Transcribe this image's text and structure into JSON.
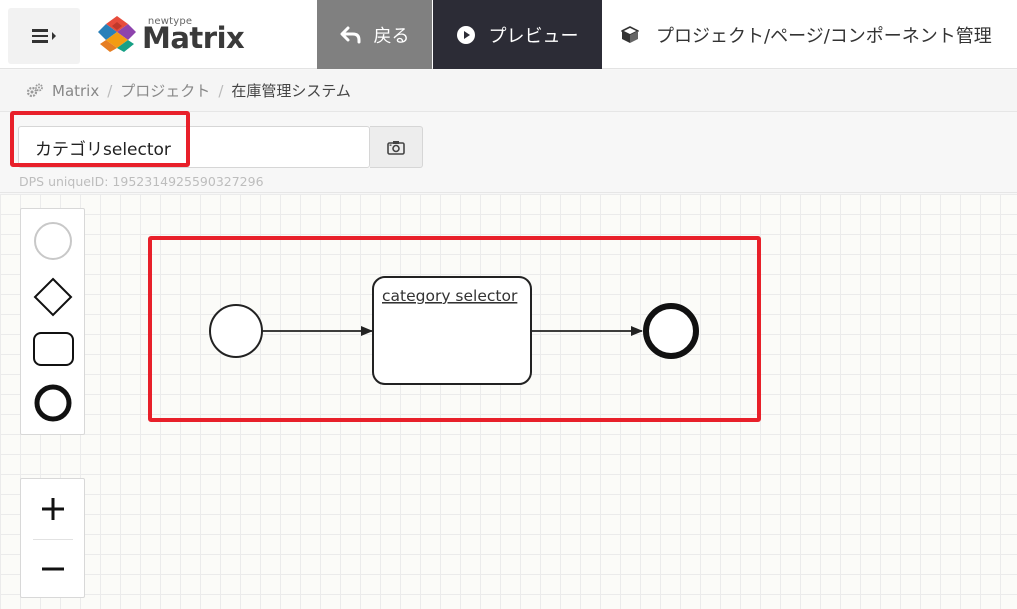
{
  "header": {
    "logo_sub": "newtype",
    "logo_name": "Matrix",
    "back_label": "戻る",
    "preview_label": "プレビュー",
    "manage_label": "プロジェクト/ページ/コンポーネント管理"
  },
  "breadcrumb": {
    "items": [
      "Matrix",
      "プロジェクト",
      "在庫管理システム"
    ]
  },
  "component": {
    "name_value": "カテゴリselector",
    "uid_text": "DPS uniqueID: 1952314925590327296"
  },
  "diagram": {
    "task_label": "category selector"
  },
  "palette": {
    "items": [
      "start-event",
      "gateway",
      "task",
      "end-event"
    ]
  },
  "zoom": {
    "in_label": "+",
    "out_label": "−"
  },
  "colors": {
    "highlight": "#e8202a",
    "back_bg": "#808080",
    "preview_bg": "#2c2c36"
  }
}
